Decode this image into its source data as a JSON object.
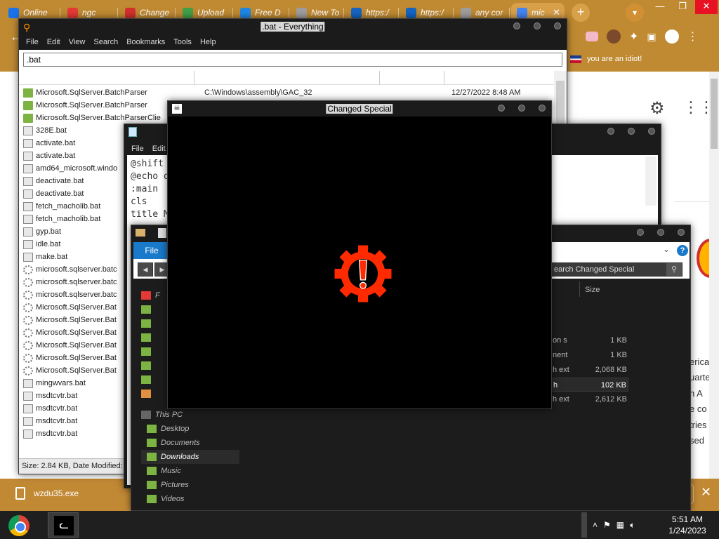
{
  "browser": {
    "tabs": [
      {
        "label": "Online",
        "fav": "#1a73e8"
      },
      {
        "label": "ngc",
        "fav": "#e53935"
      },
      {
        "label": "Change",
        "fav": "#d32f2f"
      },
      {
        "label": "Upload",
        "fav": "#43a047"
      },
      {
        "label": "Free D",
        "fav": "#1e88e5"
      },
      {
        "label": "New To",
        "fav": "#9e9e9e"
      },
      {
        "label": "https:/",
        "fav": "#1565c0"
      },
      {
        "label": "https:/",
        "fav": "#1565c0"
      },
      {
        "label": "any cor",
        "fav": "#9e9e9e"
      },
      {
        "label": "mic",
        "fav": "#4285f4"
      }
    ],
    "new_tab_symbol": "+",
    "bookmark": "you are an idiot!",
    "page_snippets": [
      "erica",
      "uarte",
      "h A",
      "e co",
      "tries",
      "sed"
    ],
    "accent": "#c08a32"
  },
  "download": {
    "filename": "wzdu35.exe",
    "close_symbol": "✕"
  },
  "everything": {
    "title": ".bat - Everything",
    "menu": [
      "File",
      "Edit",
      "View",
      "Search",
      "Bookmarks",
      "Tools",
      "Help"
    ],
    "search_value": ".bat",
    "rows": [
      {
        "name": "Microsoft.SqlServer.BatchParser",
        "icon": "folder",
        "path": "C:\\Windows\\assembly\\GAC_32",
        "date": "12/27/2022 8:48 AM"
      },
      {
        "name": "Microsoft.SqlServer.BatchParser",
        "icon": "folder",
        "path": "",
        "date": ""
      },
      {
        "name": "Microsoft.SqlServer.BatchParserClie",
        "icon": "folder",
        "path": "",
        "date": ""
      },
      {
        "name": "328E.bat",
        "icon": "bat",
        "path": "",
        "date": ""
      },
      {
        "name": "activate.bat",
        "icon": "bat",
        "path": "",
        "date": ""
      },
      {
        "name": "activate.bat",
        "icon": "bat",
        "path": "",
        "date": ""
      },
      {
        "name": "amd64_microsoft.windo",
        "icon": "bat",
        "path": "",
        "date": ""
      },
      {
        "name": "deactivate.bat",
        "icon": "bat",
        "path": "",
        "date": ""
      },
      {
        "name": "deactivate.bat",
        "icon": "bat",
        "path": "",
        "date": ""
      },
      {
        "name": "fetch_macholib.bat",
        "icon": "bat",
        "path": "",
        "date": ""
      },
      {
        "name": "fetch_macholib.bat",
        "icon": "bat",
        "path": "",
        "date": ""
      },
      {
        "name": "gyp.bat",
        "icon": "bat",
        "path": "",
        "date": ""
      },
      {
        "name": "idle.bat",
        "icon": "bat",
        "path": "",
        "date": ""
      },
      {
        "name": "make.bat",
        "icon": "bat",
        "path": "",
        "date": ""
      },
      {
        "name": "microsoft.sqlserver.batc",
        "icon": "gear",
        "path": "",
        "date": ""
      },
      {
        "name": "microsoft.sqlserver.batc",
        "icon": "gear",
        "path": "",
        "date": ""
      },
      {
        "name": "microsoft.sqlserver.batc",
        "icon": "gear",
        "path": "",
        "date": ""
      },
      {
        "name": "Microsoft.SqlServer.Bat",
        "icon": "gear",
        "path": "",
        "date": ""
      },
      {
        "name": "Microsoft.SqlServer.Bat",
        "icon": "gear",
        "path": "",
        "date": ""
      },
      {
        "name": "Microsoft.SqlServer.Bat",
        "icon": "gear",
        "path": "",
        "date": ""
      },
      {
        "name": "Microsoft.SqlServer.Bat",
        "icon": "gear",
        "path": "",
        "date": ""
      },
      {
        "name": "Microsoft.SqlServer.Bat",
        "icon": "gear",
        "path": "",
        "date": ""
      },
      {
        "name": "Microsoft.SqlServer.Bat",
        "icon": "gear",
        "path": "",
        "date": ""
      },
      {
        "name": "mingwvars.bat",
        "icon": "bat",
        "path": "",
        "date": ""
      },
      {
        "name": "msdtcvtr.bat",
        "icon": "bat",
        "path": "",
        "date": ""
      },
      {
        "name": "msdtcvtr.bat",
        "icon": "bat",
        "path": "",
        "date": ""
      },
      {
        "name": "msdtcvtr.bat",
        "icon": "bat",
        "path": "",
        "date": ""
      },
      {
        "name": "msdtcvtr.bat",
        "icon": "bat",
        "path": "",
        "date": ""
      }
    ],
    "status": "Size: 2.84 KB, Date Modified:"
  },
  "notepad": {
    "menu": [
      "File",
      "Edit"
    ],
    "lines": [
      "@shift",
      "@echo o",
      ":main",
      "cls",
      "title M"
    ]
  },
  "explorer": {
    "file_tab": "File",
    "search_placeholder": "earch Changed Special",
    "help_symbol": "?",
    "size_header": "Size",
    "quick_label": "F",
    "this_pc": "This PC",
    "nav": [
      "Desktop",
      "Documents",
      "Downloads",
      "Music",
      "Pictures",
      "Videos"
    ],
    "selected_nav": "Downloads",
    "files": [
      {
        "type": "on s",
        "size": "1 KB",
        "selected": false
      },
      {
        "type": "nent",
        "size": "1 KB",
        "selected": false
      },
      {
        "type": "h ext",
        "size": "2,068 KB",
        "selected": false
      },
      {
        "type": "h",
        "size": "102 KB",
        "selected": true
      },
      {
        "type": "h ext",
        "size": "2,612 KB",
        "selected": false
      }
    ]
  },
  "special": {
    "title": "Changed Special",
    "logo_color": "#ff2a00"
  },
  "taskbar": {
    "time": "5:51 AM",
    "date": "1/24/2023"
  }
}
